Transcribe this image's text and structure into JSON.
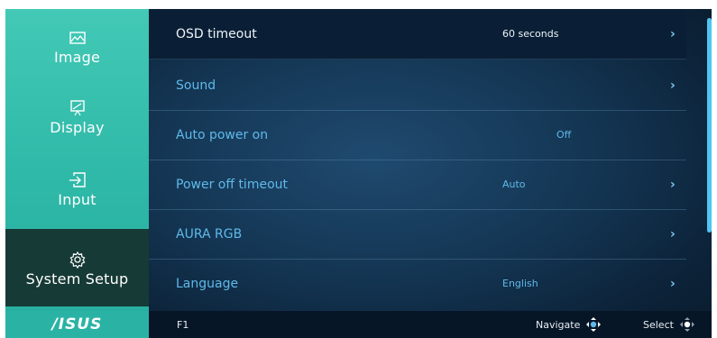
{
  "sidebar": {
    "items": [
      {
        "label": "Image",
        "icon": "image-icon"
      },
      {
        "label": "Display",
        "icon": "display-icon"
      },
      {
        "label": "Input",
        "icon": "input-icon"
      },
      {
        "label": "System Setup",
        "icon": "gear-icon",
        "active": true
      }
    ],
    "logo": "/ISUS"
  },
  "menu": {
    "rows": [
      {
        "label": "OSD timeout",
        "value": "60 seconds",
        "has_arrow": true,
        "selected": true
      },
      {
        "label": "Sound",
        "value": "",
        "has_arrow": true
      },
      {
        "label": "Auto power on",
        "value": "Off",
        "has_arrow": false
      },
      {
        "label": "Power off timeout",
        "value": "Auto",
        "has_arrow": true
      },
      {
        "label": "AURA RGB",
        "value": "",
        "has_arrow": true
      },
      {
        "label": "Language",
        "value": "English",
        "has_arrow": true
      }
    ],
    "arrow": "›"
  },
  "footer": {
    "f1": "F1",
    "navigate": "Navigate",
    "select": "Select"
  },
  "colors": {
    "accent": "#43c9b6",
    "text_highlight": "#5fb9ea",
    "scrollbar": "#4fc6f2"
  }
}
